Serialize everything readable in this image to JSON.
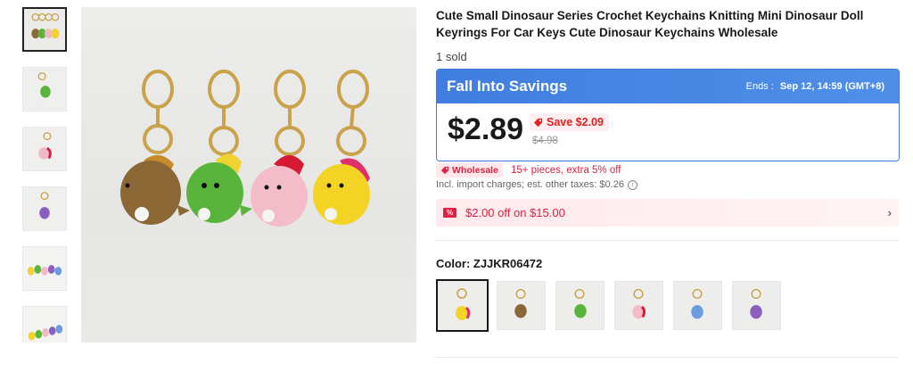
{
  "product": {
    "title": "Cute Small Dinosaur Series Crochet Keychains Knitting Mini Dinosaur Doll Keyrings For Car Keys Cute Dinosaur Keychains Wholesale",
    "sold": "1 sold"
  },
  "promo": {
    "title": "Fall Into Savings",
    "ends_label": "Ends :",
    "ends_value": "Sep 12, 14:59 (GMT+8)",
    "price": "$2.89",
    "save": "Save $2.09",
    "old_price": "$4.98",
    "accent_color": "#3f7ee0"
  },
  "wholesale": {
    "badge": "Wholesale",
    "text": "15+ pieces, extra 5% off"
  },
  "tax": {
    "text": "Incl. import charges; est. other taxes: $0.26"
  },
  "coupon": {
    "icon_label": "%",
    "text": "$2.00 off on $15.00",
    "chevron": "›"
  },
  "color": {
    "label": "Color: ZJJKR06472",
    "options": [
      "yellow",
      "brown",
      "green",
      "pink",
      "blue",
      "purple"
    ],
    "selected_index": 0
  },
  "gallery": {
    "thumbnails": [
      "all-four",
      "green",
      "pink",
      "purple",
      "group",
      "row"
    ],
    "selected_index": 0
  }
}
